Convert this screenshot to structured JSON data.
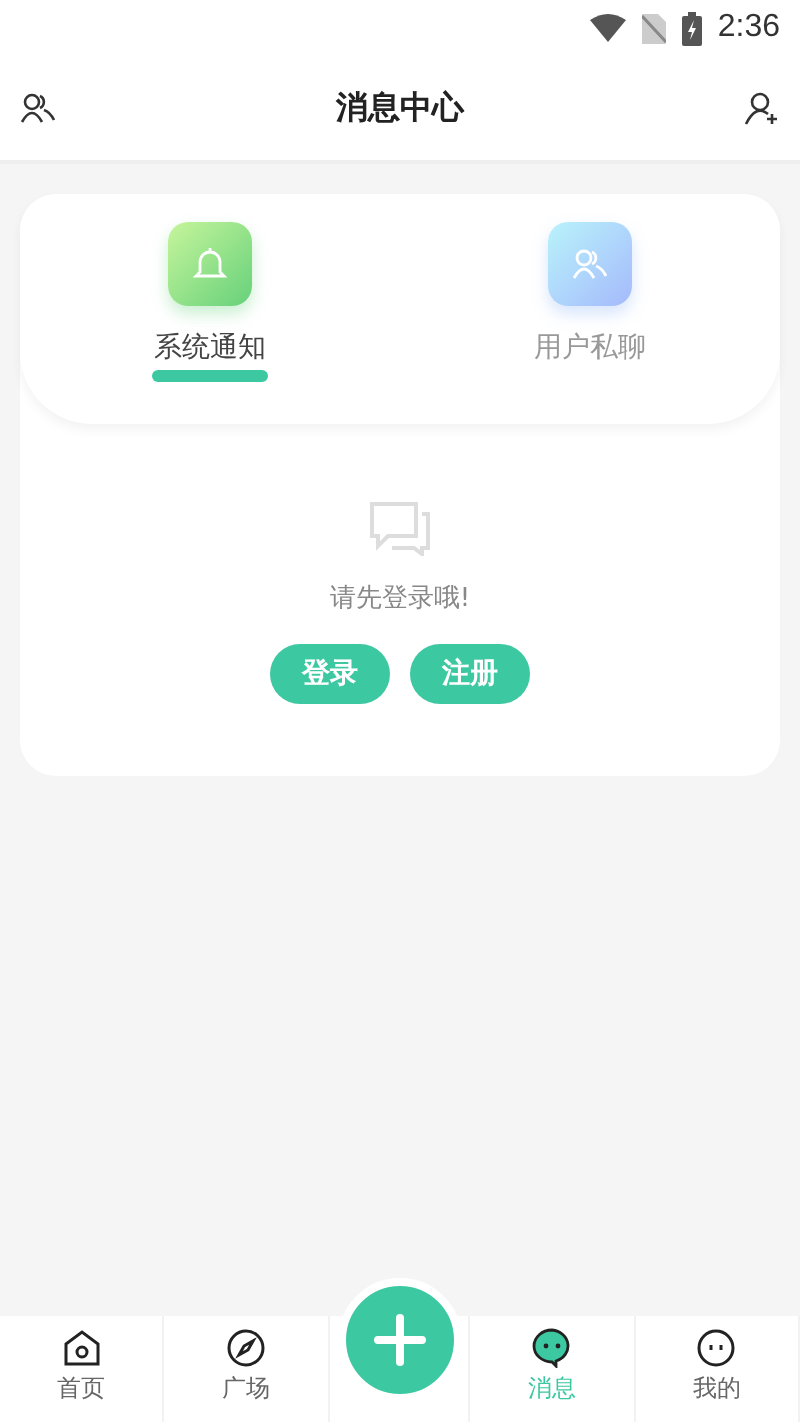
{
  "status_bar": {
    "time": "2:36"
  },
  "header": {
    "title": "消息中心"
  },
  "tabs": [
    {
      "label": "系统通知",
      "selected": true,
      "kind": "notice"
    },
    {
      "label": "用户私聊",
      "selected": false,
      "kind": "chat"
    }
  ],
  "empty_state": {
    "message": "请先登录哦!",
    "buttons": [
      "登录",
      "注册"
    ]
  },
  "bottom_nav": [
    {
      "label": "首页",
      "kind": "home",
      "selected": false
    },
    {
      "label": "广场",
      "kind": "compass",
      "selected": false
    },
    {
      "kind": "add"
    },
    {
      "label": "消息",
      "kind": "message",
      "selected": true
    },
    {
      "label": "我的",
      "kind": "face",
      "selected": false
    }
  ]
}
